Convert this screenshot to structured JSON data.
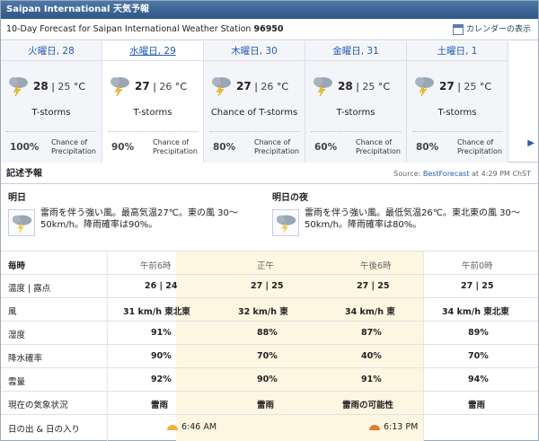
{
  "window": {
    "title": "Saipan International 天気予報"
  },
  "subheader": {
    "prefix": "10-Day Forecast for Saipan International Weather Station",
    "station_id": "96950",
    "calendar_link": "カレンダーの表示"
  },
  "days": [
    {
      "name": "火曜日, 28",
      "hi": "28",
      "lo": "25",
      "unit": "°C",
      "cond": "T-storms",
      "pct": "100%",
      "chance": "Chance of Precipitation"
    },
    {
      "name": "水曜日, 29",
      "hi": "27",
      "lo": "26",
      "unit": "°C",
      "cond": "T-storms",
      "pct": "90%",
      "chance": "Chance of Precipitation"
    },
    {
      "name": "木曜日, 30",
      "hi": "27",
      "lo": "26",
      "unit": "°C",
      "cond": "Chance of T-storms",
      "pct": "80%",
      "chance": "Chance of Precipitation"
    },
    {
      "name": "金曜日, 31",
      "hi": "28",
      "lo": "25",
      "unit": "°C",
      "cond": "T-storms",
      "pct": "60%",
      "chance": "Chance of Precipitation"
    },
    {
      "name": "土曜日, 1",
      "hi": "27",
      "lo": "25",
      "unit": "°C",
      "cond": "T-storms",
      "pct": "80%",
      "chance": "Chance of Precipitation"
    }
  ],
  "narrative": {
    "heading": "記述予報",
    "source_prefix": "Source:",
    "source_link": "BestForecast",
    "source_suffix": "at 4:29 PM ChST",
    "today_title": "明日",
    "today_text": "雷雨を伴う強い風。最高気温27℃。東の風 30～50km/h。降雨確率は90%。",
    "tonight_title": "明日の夜",
    "tonight_text": "雷雨を伴う強い風。最低気温26℃。東北東の風 30～50km/h。降雨確率は80%。"
  },
  "hourly": {
    "header_label": "毎時",
    "times": [
      "午前6時",
      "正午",
      "午後6時",
      "午前0時"
    ],
    "rows": [
      {
        "label": "温度 | 露点",
        "values": [
          "26 | 24",
          "27 | 25",
          "27 | 25",
          "27 | 25"
        ]
      },
      {
        "label": "風",
        "values": [
          "31 km/h 東北東",
          "32 km/h 東",
          "34 km/h 東",
          "34 km/h 東北東"
        ]
      },
      {
        "label": "湿度",
        "values": [
          "91%",
          "88%",
          "87%",
          "89%"
        ]
      },
      {
        "label": "降水確率",
        "values": [
          "90%",
          "70%",
          "40%",
          "70%"
        ]
      },
      {
        "label": "雲量",
        "values": [
          "92%",
          "90%",
          "91%",
          "94%"
        ]
      },
      {
        "label": "現在の気象状況",
        "values": [
          "雷雨",
          "雷雨",
          "雷雨の可能性",
          "雷雨"
        ]
      }
    ],
    "sun_label": "日の出 & 日の入り",
    "sunrise": "6:46 AM",
    "sunset": "6:13 PM"
  },
  "icons": {
    "storm": "thunderstorm-icon",
    "next": "next-arrow-icon",
    "calendar": "calendar-icon"
  }
}
